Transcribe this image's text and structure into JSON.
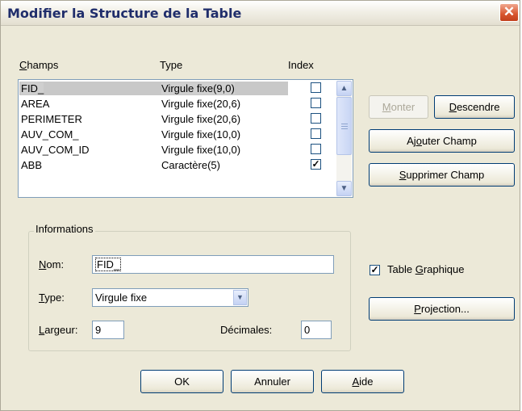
{
  "window": {
    "title": "Modifier la Structure de la Table",
    "close_glyph": "✕"
  },
  "columns": {
    "fields_prefix": "C",
    "fields_rest": "hamps",
    "type": "Type",
    "index": "Index"
  },
  "fields": [
    {
      "name": "FID_",
      "type": "Virgule fixe(9,0)",
      "indexed": false,
      "selected": true
    },
    {
      "name": "AREA",
      "type": "Virgule fixe(20,6)",
      "indexed": false,
      "selected": false
    },
    {
      "name": "PERIMETER",
      "type": "Virgule fixe(20,6)",
      "indexed": false,
      "selected": false
    },
    {
      "name": "AUV_COM_",
      "type": "Virgule fixe(10,0)",
      "indexed": false,
      "selected": false
    },
    {
      "name": "AUV_COM_ID",
      "type": "Virgule fixe(10,0)",
      "indexed": false,
      "selected": false
    },
    {
      "name": "ABB",
      "type": "Caractère(5)",
      "indexed": true,
      "selected": false
    }
  ],
  "checkmark": "✓",
  "scroll": {
    "up": "▲",
    "down": "▼"
  },
  "buttons": {
    "monter_prefix": "M",
    "monter_rest": "onter",
    "descendre_prefix": "D",
    "descendre_rest": "escendre",
    "ajouter_pre": "Aj",
    "ajouter_u": "o",
    "ajouter_rest": "uter Champ",
    "supprimer_prefix": "S",
    "supprimer_rest": "upprimer Champ",
    "projection_prefix": "P",
    "projection_rest": "rojection...",
    "ok": "OK",
    "annuler": "Annuler",
    "aide_prefix": "A",
    "aide_rest": "ide"
  },
  "info": {
    "legend": "Informations",
    "nom_prefix": "N",
    "nom_rest": "om:",
    "nom_value": "FID_",
    "type_prefix": "T",
    "type_rest": "ype:",
    "type_value": "Virgule fixe",
    "combo_arrow": "▼",
    "largeur_prefix": "L",
    "largeur_rest": "argeur:",
    "largeur_value": "9",
    "decimales_label": "Décimales:",
    "decimales_value": "0"
  },
  "graphic_table": {
    "checked": true,
    "label_pre": "Table ",
    "label_u": "G",
    "label_rest": "raphique"
  }
}
